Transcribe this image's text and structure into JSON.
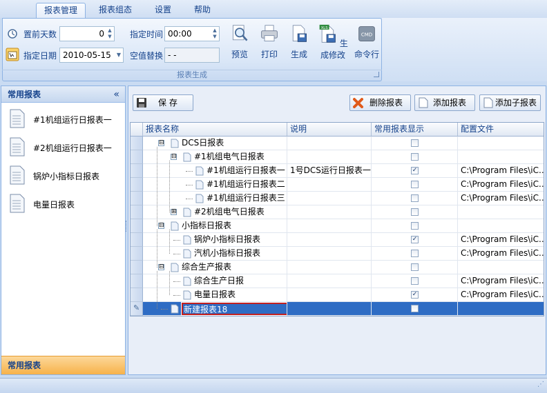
{
  "tabs": [
    {
      "label": "报表管理",
      "active": true
    },
    {
      "label": "报表组态",
      "active": false
    },
    {
      "label": "设置",
      "active": false
    },
    {
      "label": "帮助",
      "active": false
    }
  ],
  "ribbon": {
    "days_before_label": "置前天数",
    "days_before_value": "0",
    "date_label": "指定日期",
    "date_value": "2010-05-15",
    "time_label": "指定时间",
    "time_value": "00:00",
    "null_replace_label": "空值替换",
    "null_replace_value": "- -",
    "buttons": [
      "预览",
      "打印",
      "生成",
      "生成修改",
      "命令行"
    ],
    "cmd_icon_text": "CMD",
    "xls_icon_text": "XLS",
    "group_title": "报表生成"
  },
  "left_panel": {
    "title": "常用报表",
    "collapse_glyph": "«",
    "items": [
      "#1机组运行日报表一",
      "#2机组运行日报表一",
      "锅炉小指标日报表",
      "电量日报表"
    ],
    "footer": "常用报表"
  },
  "toolbar": {
    "save_label": "保  存",
    "delete_label": "删除报表",
    "add_label": "添加报表",
    "add_child_label": "添加子报表"
  },
  "grid": {
    "columns": [
      "报表名称",
      "说明",
      "常用报表显示",
      "配置文件"
    ],
    "rows": [
      {
        "name": "DCS日报表",
        "desc": "",
        "checked": false,
        "config": ""
      },
      {
        "name": "#1机组电气日报表",
        "desc": "",
        "checked": false,
        "config": ""
      },
      {
        "name": "#1机组运行日报表一",
        "desc": "1号DCS运行日报表一",
        "checked": true,
        "config": "C:\\Program Files\\iC..."
      },
      {
        "name": "#1机组运行日报表二",
        "desc": "",
        "checked": false,
        "config": "C:\\Program Files\\iC..."
      },
      {
        "name": "#1机组运行日报表三",
        "desc": "",
        "checked": false,
        "config": "C:\\Program Files\\iC..."
      },
      {
        "name": "#2机组电气日报表",
        "desc": "",
        "checked": false,
        "config": ""
      },
      {
        "name": "小指标日报表",
        "desc": "",
        "checked": false,
        "config": ""
      },
      {
        "name": "锅炉小指标日报表",
        "desc": "",
        "checked": true,
        "config": "C:\\Program Files\\iC..."
      },
      {
        "name": "汽机小指标日报表",
        "desc": "",
        "checked": false,
        "config": "C:\\Program Files\\iC..."
      },
      {
        "name": "综合生产报表",
        "desc": "",
        "checked": false,
        "config": ""
      },
      {
        "name": "综合生产日报",
        "desc": "",
        "checked": false,
        "config": "C:\\Program Files\\iC..."
      },
      {
        "name": "电量日报表",
        "desc": "",
        "checked": true,
        "config": "C:\\Program Files\\iC..."
      },
      {
        "name": "新建报表18",
        "desc": "",
        "checked": false,
        "config": ""
      }
    ],
    "expanders": [
      "⊟",
      "⊟",
      "⊞",
      "⊟",
      "⊟"
    ],
    "edit_glyph": "✎",
    "check_glyph": "✓"
  },
  "colors": {
    "accent": "#2e6cc4",
    "footer_orange": "#f7b24a",
    "edit_border": "#c02020"
  }
}
